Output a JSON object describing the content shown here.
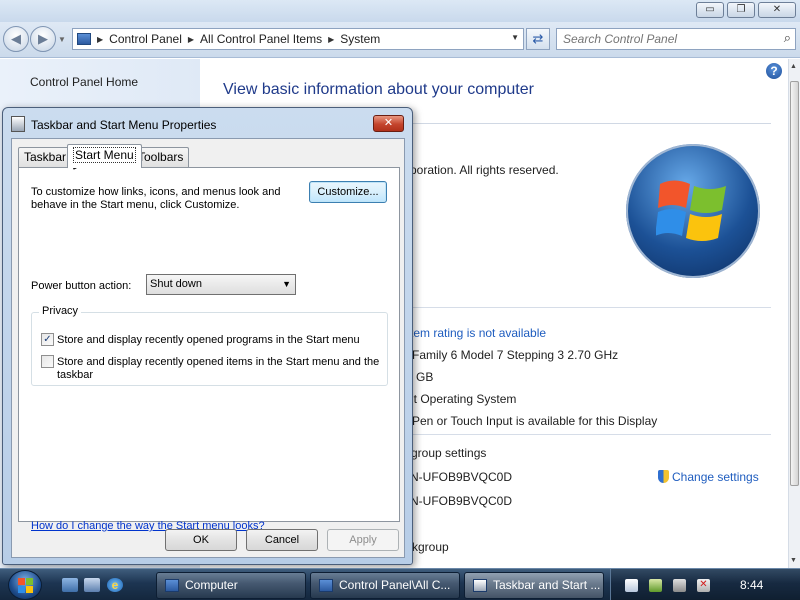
{
  "explorer": {
    "window_buttons": {
      "minimize": "▭",
      "maximize": "❐",
      "close": "✕"
    },
    "breadcrumb": [
      "Control Panel",
      "All Control Panel Items",
      "System"
    ],
    "search_placeholder": "Search Control Panel",
    "left_nav": {
      "home": "Control Panel Home"
    },
    "main": {
      "title": "View basic information about your computer",
      "copyright": "poration.  All rights reserved.",
      "rating_link": "tem rating is not available",
      "processor": "Family 6 Model 7 Stepping 3   2.70 GHz",
      "memory": "GB",
      "system_type": "it Operating System",
      "pen_touch": "Pen or Touch Input is available for this Display",
      "section_workgroup": "group settings",
      "computer_name": "N-UFOB9BVQC0D",
      "full_name": "N-UFOB9BVQC0D",
      "workgroup_cut": "kgroup",
      "change_settings": "Change settings"
    }
  },
  "dialog": {
    "title": "Taskbar and Start Menu Properties",
    "close": "✕",
    "tabs": [
      "Taskbar",
      "Start Menu",
      "Toolbars"
    ],
    "active_tab": "Start Menu",
    "description": "To customize how links, icons, and menus look and behave in the Start menu, click Customize.",
    "customize_button": "Customize...",
    "power_label": "Power button action:",
    "power_value": "Shut down",
    "privacy_legend": "Privacy",
    "privacy_options": [
      {
        "label": "Store and display recently opened programs in the Start menu",
        "checked": true
      },
      {
        "label": "Store and display recently opened items in the Start menu and the taskbar",
        "checked": false
      }
    ],
    "help_link": "How do I change the way the Start menu looks?",
    "buttons": {
      "ok": "OK",
      "cancel": "Cancel",
      "apply": "Apply"
    }
  },
  "taskbar": {
    "tasks": [
      "Computer",
      "Control Panel\\All C...",
      "Taskbar and Start ..."
    ],
    "active_task": "Taskbar and Start ...",
    "clock": "8:44"
  },
  "colors": {
    "accent": "#1f3a8a",
    "link": "#1f5dbf",
    "dialog_frame": "#b7cde7",
    "taskbar": "#1d3552"
  }
}
